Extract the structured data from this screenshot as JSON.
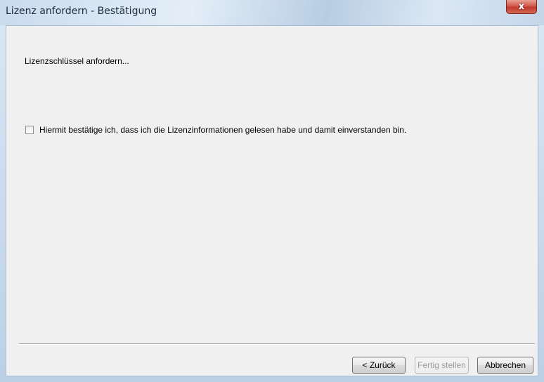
{
  "window": {
    "title": "Lizenz anfordern - Bestätigung",
    "close_glyph": "x"
  },
  "content": {
    "heading": "Lizenzschlüssel anfordern...",
    "confirm_checkbox": {
      "label": "Hiermit bestätige ich, dass ich die Lizenzinformationen gelesen habe und damit einverstanden bin.",
      "checked": false
    }
  },
  "buttons": {
    "back_label": "< Zurück",
    "finish_label": "Fertig stellen",
    "finish_enabled": false,
    "cancel_label": "Abbrechen"
  },
  "colors": {
    "close_button": "#c9493a",
    "dialog_background": "#f0f0f0",
    "disabled_text": "#9b9b9b"
  }
}
